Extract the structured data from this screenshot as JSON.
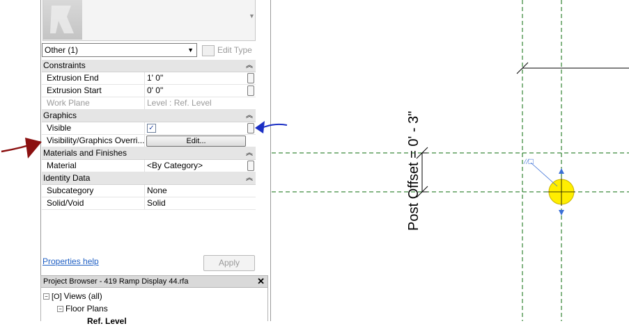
{
  "properties": {
    "selector_value": "Other (1)",
    "edit_type_label": "Edit Type",
    "sections": [
      {
        "title": "Constraints",
        "rows": [
          {
            "label": "Extrusion End",
            "value": "1'  0\""
          },
          {
            "label": "Extrusion Start",
            "value": "0'  0\""
          },
          {
            "label": "Work Plane",
            "value": "Level : Ref. Level"
          }
        ]
      },
      {
        "title": "Graphics",
        "rows": [
          {
            "label": "Visible",
            "value": "✓"
          },
          {
            "label": "Visibility/Graphics Overri...",
            "value": "Edit..."
          }
        ]
      },
      {
        "title": "Materials and Finishes",
        "rows": [
          {
            "label": "Material",
            "value": "<By Category>"
          }
        ]
      },
      {
        "title": "Identity Data",
        "rows": [
          {
            "label": "Subcategory",
            "value": "None"
          },
          {
            "label": "Solid/Void",
            "value": "Solid"
          }
        ]
      }
    ],
    "help_link": "Properties help",
    "apply_label": "Apply"
  },
  "project_browser": {
    "title": "Project Browser - 419 Ramp Display 44.rfa",
    "close_label": "✕",
    "tree": [
      {
        "label": "Views (all)",
        "toggle": "−"
      },
      {
        "label": "Floor Plans",
        "toggle": "−"
      },
      {
        "label": "Ref. Level"
      }
    ]
  },
  "canvas": {
    "dimension_label": "Post Offset = 0' - 3\"",
    "colors": {
      "reference_line": "#0a6b0a",
      "post_fill": "#ffee00",
      "grip": "#3a6fd6",
      "annotation_arrow_red": "#8b1010",
      "annotation_arrow_blue": "#1b2fc4"
    }
  }
}
